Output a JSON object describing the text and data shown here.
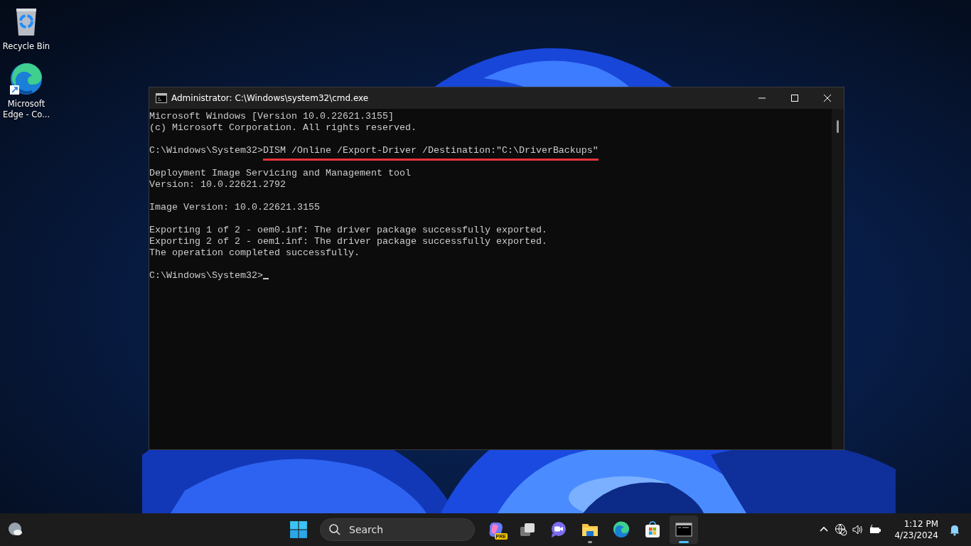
{
  "desktop": {
    "icons": [
      {
        "kind": "recycle-bin",
        "label": "Recycle Bin"
      },
      {
        "kind": "edge-shortcut",
        "label": "Microsoft Edge - Co..."
      }
    ]
  },
  "window": {
    "title": "Administrator: C:\\Windows\\system32\\cmd.exe",
    "console": {
      "blocks": [
        {
          "lines": [
            {
              "text": "Microsoft Windows [Version 10.0.22621.3155]"
            },
            {
              "text": "(c) Microsoft Corporation. All rights reserved."
            }
          ]
        },
        {
          "lines": [
            {
              "prompt": "C:\\Windows\\System32>",
              "command": "DISM /Online /Export-Driver /Destination:\"C:\\DriverBackups\"",
              "underlined": true
            }
          ]
        },
        {
          "lines": [
            {
              "text": "Deployment Image Servicing and Management tool"
            },
            {
              "text": "Version: 10.0.22621.2792"
            }
          ]
        },
        {
          "lines": [
            {
              "text": "Image Version: 10.0.22621.3155"
            }
          ]
        },
        {
          "lines": [
            {
              "text": "Exporting 1 of 2 - oem0.inf: The driver package successfully exported."
            },
            {
              "text": "Exporting 2 of 2 - oem1.inf: The driver package successfully exported."
            },
            {
              "text": "The operation completed successfully."
            }
          ]
        },
        {
          "lines": [
            {
              "prompt": "C:\\Windows\\System32>",
              "cursor": true
            }
          ]
        }
      ]
    }
  },
  "taskbar": {
    "search": {
      "placeholder": "Search"
    },
    "apps": [
      {
        "kind": "copilot",
        "badge": "PRE",
        "running": false,
        "active": false
      },
      {
        "kind": "task-view",
        "running": false,
        "active": false
      },
      {
        "kind": "chat",
        "running": false,
        "active": false
      },
      {
        "kind": "folder",
        "running": true,
        "active": false
      },
      {
        "kind": "edge",
        "running": false,
        "active": false
      },
      {
        "kind": "store",
        "running": false,
        "active": false
      },
      {
        "kind": "terminal",
        "running": true,
        "active": true
      }
    ],
    "clock": {
      "time": "1:12 PM",
      "date": "4/23/2024"
    }
  }
}
